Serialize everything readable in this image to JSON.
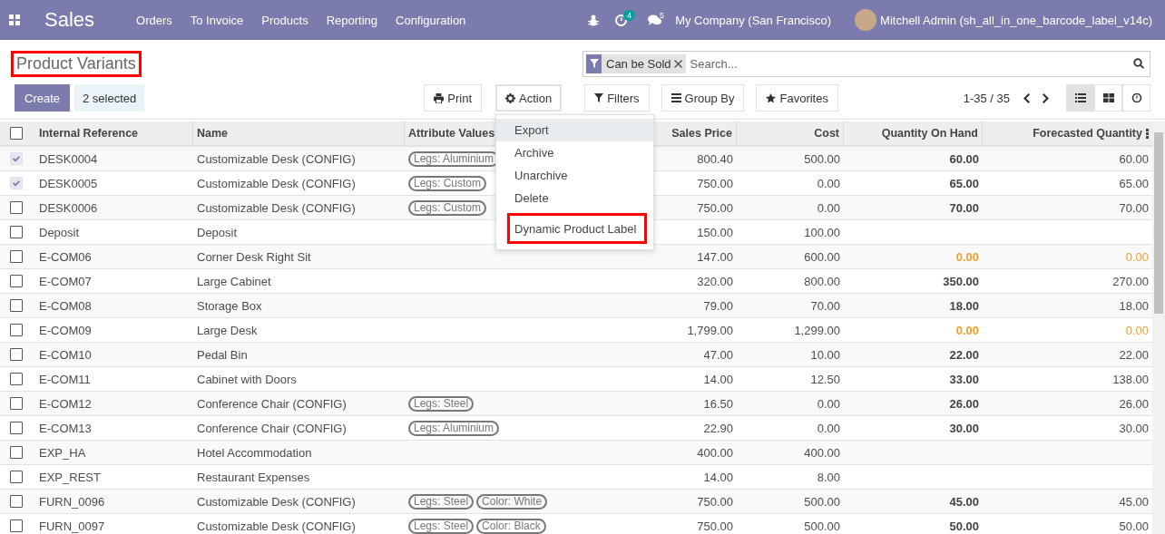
{
  "navbar": {
    "app": "Sales",
    "menu": [
      "Orders",
      "To Invoice",
      "Products",
      "Reporting",
      "Configuration"
    ],
    "activity_count": "4",
    "message_count": "5",
    "company": "My Company (San Francisco)",
    "user": "Mitchell Admin (sh_all_in_one_barcode_label_v14c)"
  },
  "title": {
    "text": "Product Variants",
    "annotated": true
  },
  "search": {
    "facet": "Can be Sold",
    "placeholder": "Search..."
  },
  "buttons": {
    "create": "Create",
    "selected": "2 selected",
    "print": "Print",
    "action": "Action",
    "filters": "Filters",
    "group_by": "Group By",
    "favorites": "Favorites"
  },
  "pager": "1-35 / 35",
  "views": [
    {
      "kind": "list",
      "selected": true
    },
    {
      "kind": "kanban",
      "selected": false
    },
    {
      "kind": "activity",
      "selected": false
    }
  ],
  "action_menu": [
    {
      "label": "Export",
      "hovered": true,
      "annotated": false
    },
    {
      "label": "Archive",
      "hovered": false,
      "annotated": false
    },
    {
      "label": "Unarchive",
      "hovered": false,
      "annotated": false
    },
    {
      "label": "Delete",
      "hovered": false,
      "annotated": false
    },
    {
      "label": "Dynamic Product Label",
      "hovered": false,
      "annotated": true
    }
  ],
  "table": {
    "select_all": false,
    "columns": [
      "Internal Reference",
      "Name",
      "Attribute Values",
      "Sales Price",
      "Cost",
      "Quantity On Hand",
      "Forecasted Quantity"
    ],
    "rows": [
      {
        "checked": true,
        "ref": "DESK0004",
        "name": "Customizable Desk (CONFIG)",
        "tags": [
          "Legs: Aluminium"
        ],
        "price": "800.40",
        "cost": "500.00",
        "on_hand": "60.00",
        "forecast": "60.00",
        "warning": false
      },
      {
        "checked": true,
        "ref": "DESK0005",
        "name": "Customizable Desk (CONFIG)",
        "tags": [
          "Legs: Custom"
        ],
        "price": "750.00",
        "cost": "0.00",
        "on_hand": "65.00",
        "forecast": "65.00",
        "warning": false
      },
      {
        "checked": false,
        "ref": "DESK0006",
        "name": "Customizable Desk (CONFIG)",
        "tags": [
          "Legs: Custom"
        ],
        "price": "750.00",
        "cost": "0.00",
        "on_hand": "70.00",
        "forecast": "70.00",
        "warning": false
      },
      {
        "checked": false,
        "ref": "Deposit",
        "name": "Deposit",
        "tags": [],
        "price": "150.00",
        "cost": "100.00"
      },
      {
        "checked": false,
        "ref": "E-COM06",
        "name": "Corner Desk Right Sit",
        "tags": [],
        "price": "147.00",
        "cost": "600.00",
        "on_hand": "0.00",
        "forecast": "0.00",
        "warning": true
      },
      {
        "checked": false,
        "ref": "E-COM07",
        "name": "Large Cabinet",
        "tags": [],
        "price": "320.00",
        "cost": "800.00",
        "on_hand": "350.00",
        "forecast": "270.00",
        "warning": false
      },
      {
        "checked": false,
        "ref": "E-COM08",
        "name": "Storage Box",
        "tags": [],
        "price": "79.00",
        "cost": "70.00",
        "on_hand": "18.00",
        "forecast": "18.00",
        "warning": false
      },
      {
        "checked": false,
        "ref": "E-COM09",
        "name": "Large Desk",
        "tags": [],
        "price": "1,799.00",
        "cost": "1,299.00",
        "on_hand": "0.00",
        "forecast": "0.00",
        "warning": true
      },
      {
        "checked": false,
        "ref": "E-COM10",
        "name": "Pedal Bin",
        "tags": [],
        "price": "47.00",
        "cost": "10.00",
        "on_hand": "22.00",
        "forecast": "22.00",
        "warning": false
      },
      {
        "checked": false,
        "ref": "E-COM11",
        "name": "Cabinet with Doors",
        "tags": [],
        "price": "14.00",
        "cost": "12.50",
        "on_hand": "33.00",
        "forecast": "138.00",
        "warning": false
      },
      {
        "checked": false,
        "ref": "E-COM12",
        "name": "Conference Chair (CONFIG)",
        "tags": [
          "Legs: Steel"
        ],
        "price": "16.50",
        "cost": "0.00",
        "on_hand": "26.00",
        "forecast": "26.00",
        "warning": false
      },
      {
        "checked": false,
        "ref": "E-COM13",
        "name": "Conference Chair (CONFIG)",
        "tags": [
          "Legs: Aluminium"
        ],
        "price": "22.90",
        "cost": "0.00",
        "on_hand": "30.00",
        "forecast": "30.00",
        "warning": false
      },
      {
        "checked": false,
        "ref": "EXP_HA",
        "name": "Hotel Accommodation",
        "tags": [],
        "price": "400.00",
        "cost": "400.00"
      },
      {
        "checked": false,
        "ref": "EXP_REST",
        "name": "Restaurant Expenses",
        "tags": [],
        "price": "14.00",
        "cost": "8.00"
      },
      {
        "checked": false,
        "ref": "FURN_0096",
        "name": "Customizable Desk (CONFIG)",
        "tags": [
          "Legs: Steel",
          "Color: White"
        ],
        "price": "750.00",
        "cost": "500.00",
        "on_hand": "45.00",
        "forecast": "45.00",
        "warning": false
      },
      {
        "checked": false,
        "ref": "FURN_0097",
        "name": "Customizable Desk (CONFIG)",
        "tags": [
          "Legs: Steel",
          "Color: Black"
        ],
        "price": "750.00",
        "cost": "500.00",
        "on_hand": "50.00",
        "forecast": "50.00",
        "warning": false
      }
    ]
  }
}
